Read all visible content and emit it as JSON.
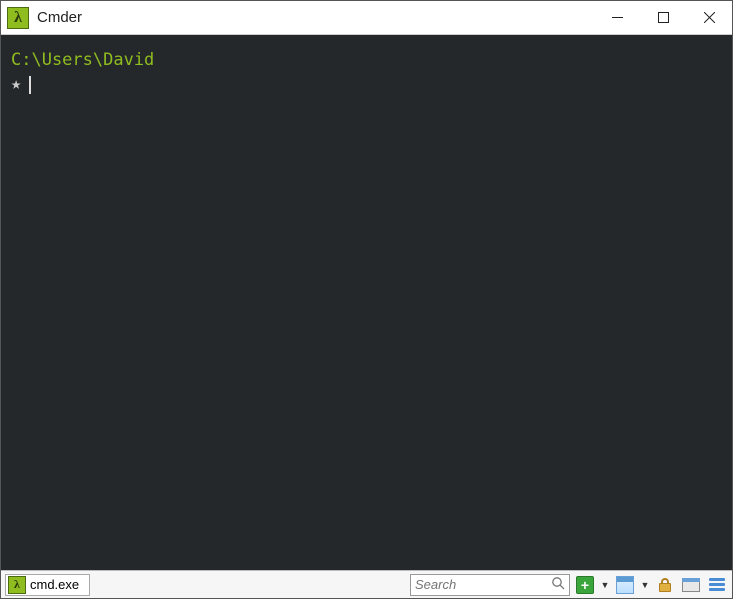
{
  "window": {
    "title": "Cmder",
    "icon_glyph": "λ"
  },
  "terminal": {
    "cwd": "C:\\Users\\David",
    "prompt_symbol": "★"
  },
  "statusbar": {
    "tab": {
      "icon_glyph": "λ",
      "label": "cmd.exe"
    },
    "search": {
      "placeholder": "Search"
    },
    "add": {
      "glyph": "+"
    }
  }
}
